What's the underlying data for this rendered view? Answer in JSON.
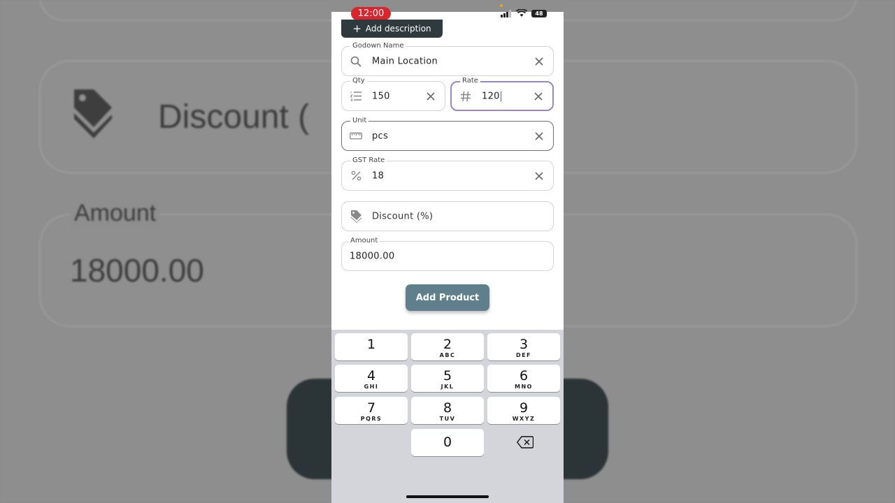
{
  "status": {
    "time": "12:00",
    "battery": "48"
  },
  "background": {
    "discount_text": "Discount (",
    "amount_label": "Amount",
    "amount_value": "18000.00"
  },
  "add_description": {
    "label": "Add description"
  },
  "fields": {
    "godown": {
      "label": "Godown Name",
      "value": "Main Location",
      "icon": "search-icon"
    },
    "qty": {
      "label": "Qty",
      "value": "150",
      "icon": "list-icon"
    },
    "rate": {
      "label": "Rate",
      "value": "120",
      "icon": "hash-icon"
    },
    "unit": {
      "label": "Unit",
      "value": "pcs",
      "icon": "ruler-icon"
    },
    "gst": {
      "label": "GST Rate",
      "value": "18",
      "icon": "percent-icon"
    },
    "discount": {
      "placeholder": "Discount (%)",
      "icon": "tag-icon"
    },
    "amount": {
      "label": "Amount",
      "value": "18000.00"
    }
  },
  "add_product_label": "Add Product",
  "keypad": {
    "keys": [
      {
        "digit": "1",
        "letters": ""
      },
      {
        "digit": "2",
        "letters": "ABC"
      },
      {
        "digit": "3",
        "letters": "DEF"
      },
      {
        "digit": "4",
        "letters": "GHI"
      },
      {
        "digit": "5",
        "letters": "JKL"
      },
      {
        "digit": "6",
        "letters": "MNO"
      },
      {
        "digit": "7",
        "letters": "PQRS"
      },
      {
        "digit": "8",
        "letters": "TUV"
      },
      {
        "digit": "9",
        "letters": "WXYZ"
      },
      {
        "digit": "0",
        "letters": ""
      }
    ]
  },
  "colors": {
    "accent": "#5f7f8c",
    "focus": "#9a86c7",
    "dark": "#2e3a3d",
    "time_pill": "#d9262e"
  }
}
